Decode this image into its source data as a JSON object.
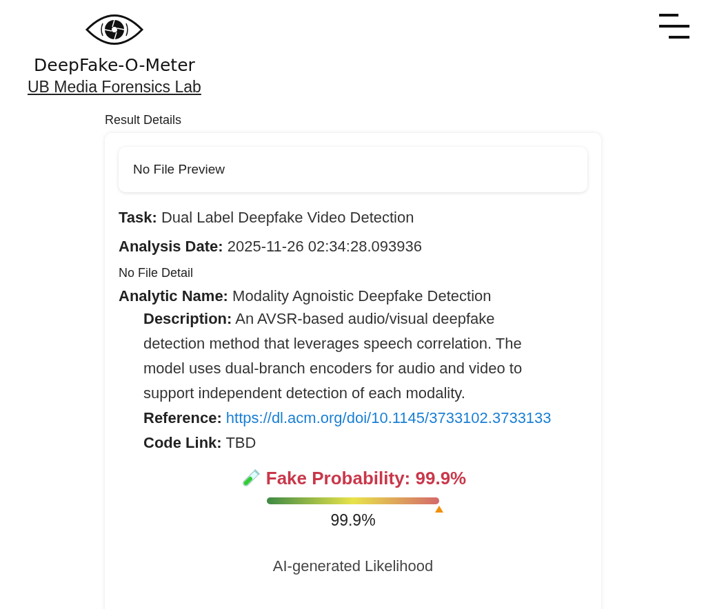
{
  "header": {
    "title": "DeepFake-O-Meter",
    "subtitle_link": "UB Media Forensics Lab"
  },
  "section_title": "Result Details",
  "result": {
    "preview": "No File Preview",
    "fields": [
      {
        "label": "Task:",
        "value": "Dual Label Deepfake Video Detection"
      },
      {
        "label": "Analysis Date:",
        "value": "2025-11-26 02:34:28.093936"
      }
    ],
    "file_detail": "No File Detail",
    "analytic": {
      "label": "Analytic Name:",
      "value": "Modality Agnoistic Deepfake Detection",
      "details": [
        {
          "kind": "text",
          "label": "Description:",
          "value": "An AVSR-based audio/visual deepfake detection method that leverages speech correlation. The model uses dual-branch encoders for audio and video to support independent detection of each modality."
        },
        {
          "kind": "link",
          "label": "Reference:",
          "value": "https://dl.acm.org/doi/10.1145/3733102.3733133"
        },
        {
          "kind": "text",
          "label": "Code Link:",
          "value": "TBD"
        }
      ]
    },
    "probability": {
      "heading": "Fake Probability: 99.9%",
      "level": 0.999,
      "reading": "99.9%",
      "caption": "AI-generated Likelihood"
    }
  }
}
